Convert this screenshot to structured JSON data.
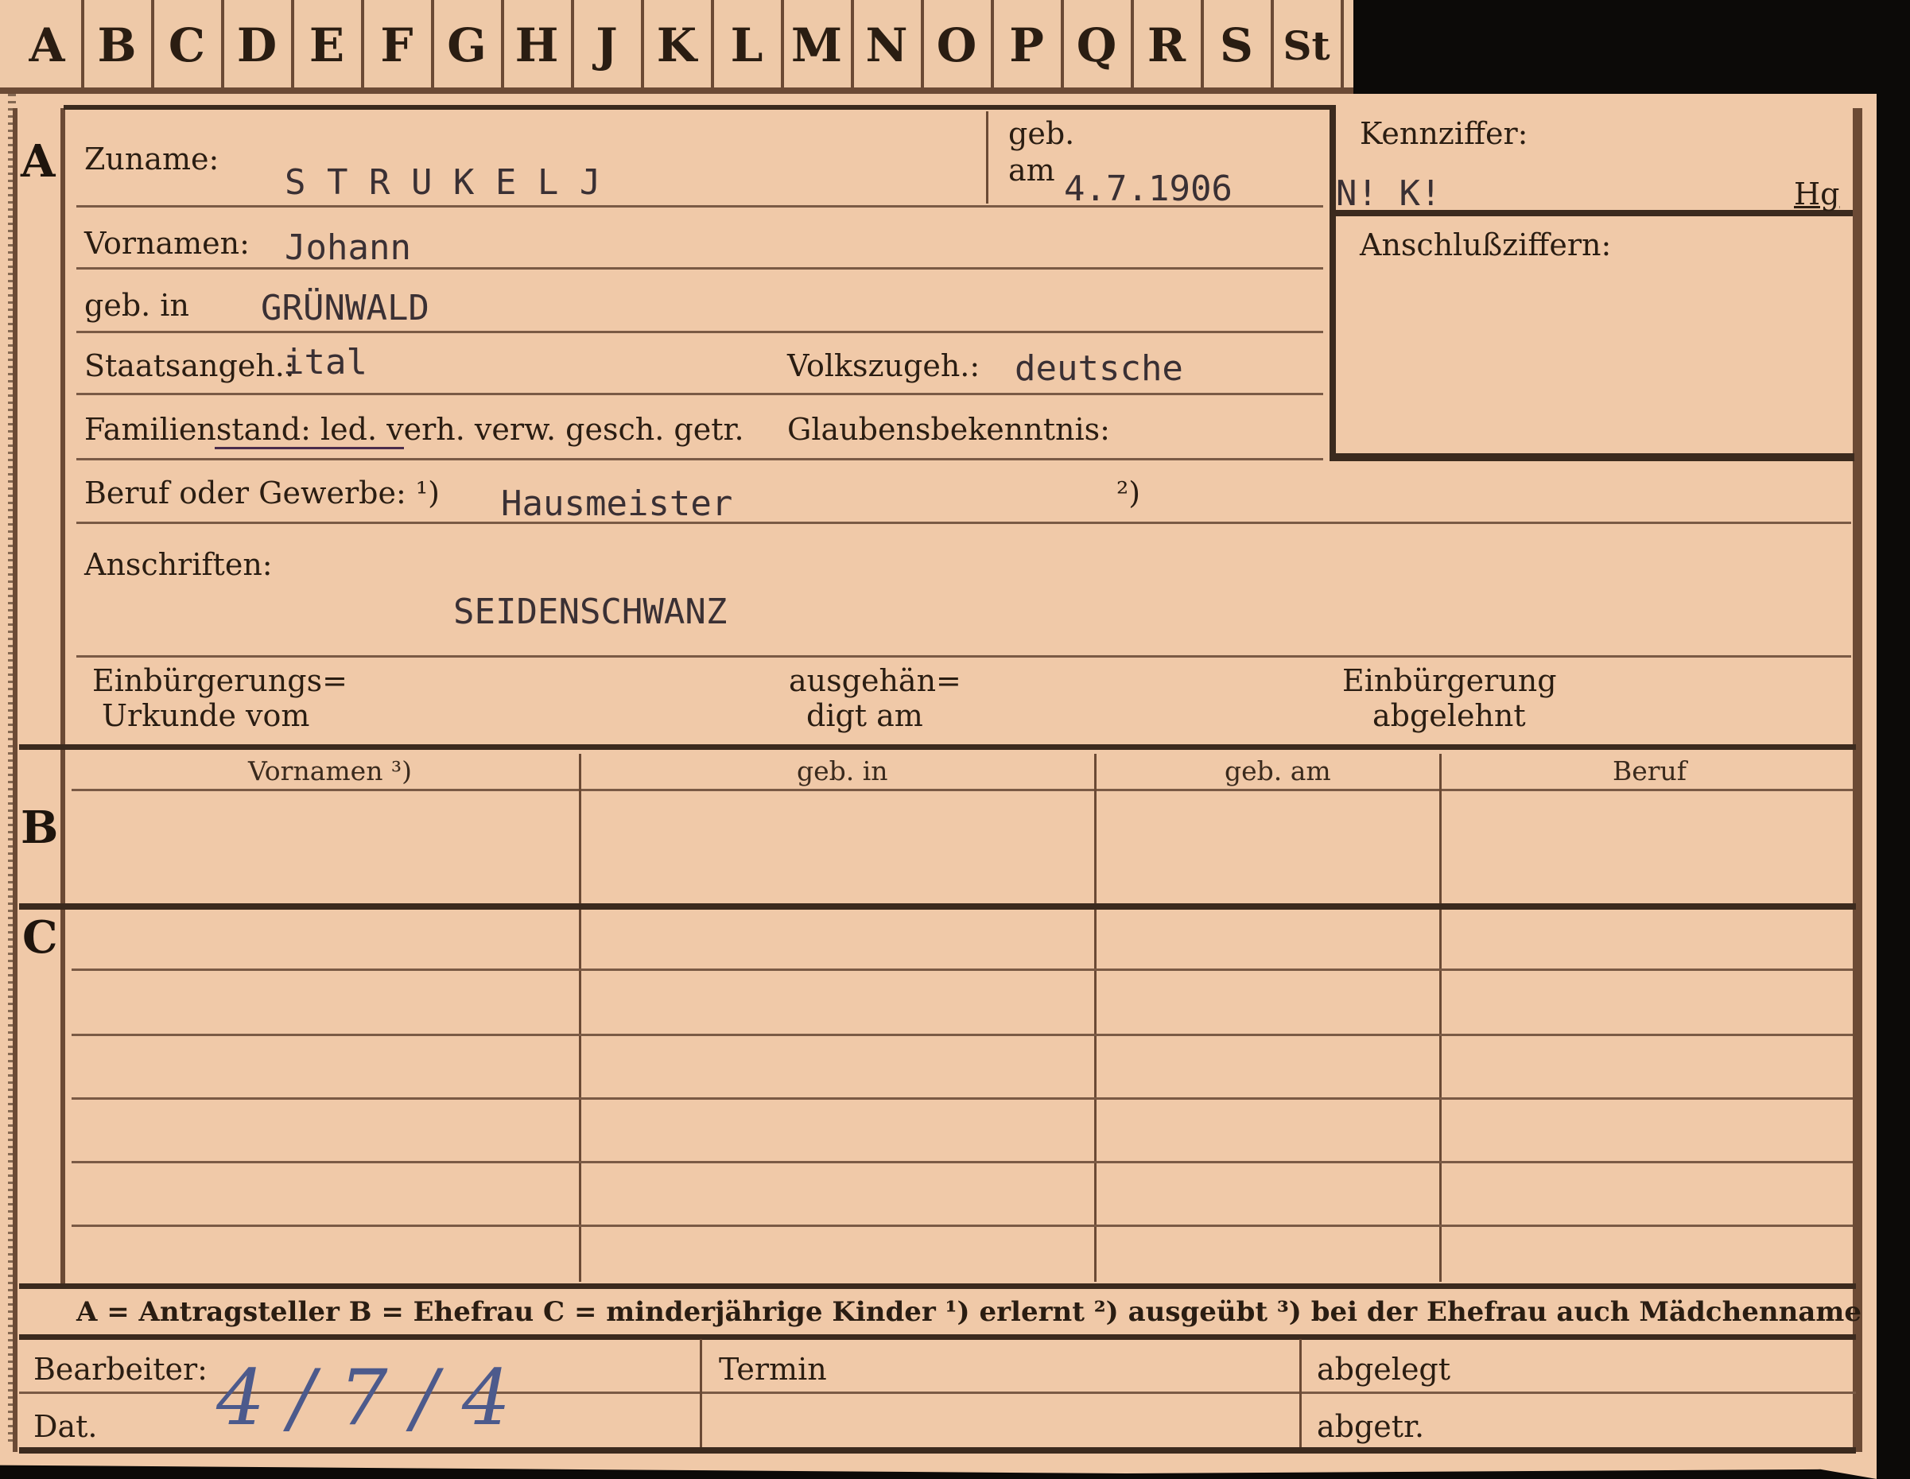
{
  "tabs": [
    "A",
    "B",
    "C",
    "D",
    "E",
    "F",
    "G",
    "H",
    "J",
    "K",
    "L",
    "M",
    "N",
    "O",
    "P",
    "Q",
    "R",
    "S",
    "St"
  ],
  "section_letters": {
    "a": "A",
    "b": "B",
    "c": "C"
  },
  "fields": {
    "zuname_label": "Zuname:",
    "zuname_value": "S T R U K E L J",
    "geb_label": "geb.",
    "am_label": "am",
    "geb_am_value": "4.7.1906",
    "kennziffer_label": "Kennziffer:",
    "kennziffer_value": "N! K!",
    "kennziffer_mark": "Hg",
    "anschluss_label": "Anschlußziffern:",
    "vornamen_label": "Vornamen:",
    "vornamen_value": "Johann",
    "geb_in_label": "geb. in",
    "geb_in_value": "GRÜNWALD",
    "staatsangeh_label": "Staatsangeh.:",
    "staatsangeh_value": "ital",
    "volkszugeh_label": "Volkszugeh.:",
    "volkszugeh_value": "deutsche",
    "familienstand_label": "Familienstand: led. verh. verw. gesch. getr.",
    "glaubens_label": "Glaubensbekenntnis:",
    "beruf_label": "Beruf oder Gewerbe: ¹)",
    "beruf_value": "Hausmeister",
    "beruf_note2": "²)",
    "anschriften_label": "Anschriften:",
    "anschriften_value": "SEIDENSCHWANZ",
    "einb_urkunde_1": "Einbürgerungs=",
    "einb_urkunde_2": "Urkunde vom",
    "ausgeh_1": "ausgehän=",
    "ausgeh_2": "digt am",
    "abgelehnt_1": "Einbürgerung",
    "abgelehnt_2": "abgelehnt"
  },
  "table_headers": [
    "Vornamen ³)",
    "geb. in",
    "geb. am",
    "Beruf"
  ],
  "legend": "A = Antragsteller   B = Ehefrau   C = minderjährige Kinder   ¹) erlernt   ²) ausgeübt   ³) bei der Ehefrau auch Mädchenname",
  "footer": {
    "bearbeiter_label": "Bearbeiter:",
    "dat_label": "Dat.",
    "termin_label": "Termin",
    "abgelegt_label": "abgelegt",
    "abgetr_label": "abgetr.",
    "handwritten_date": "4 / 7 / 4"
  }
}
